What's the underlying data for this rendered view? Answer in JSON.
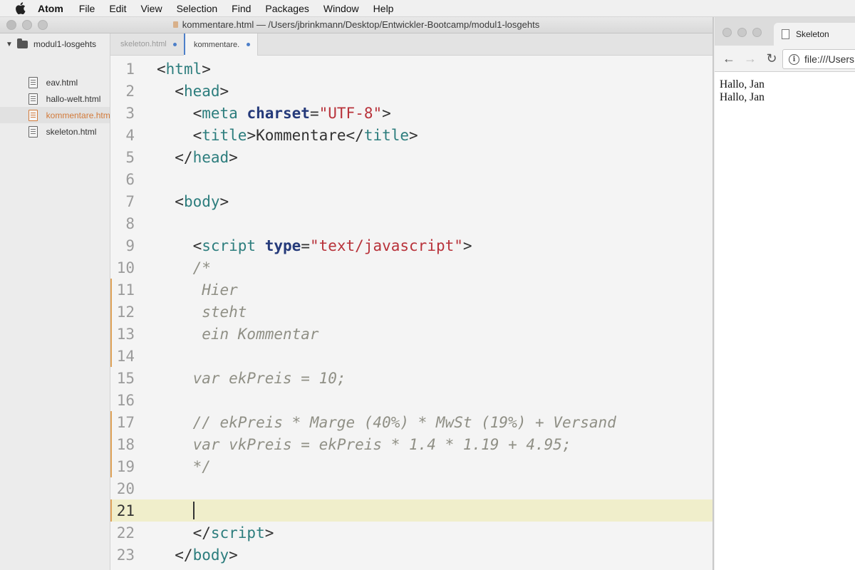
{
  "menubar": {
    "app": "Atom",
    "items": [
      "File",
      "Edit",
      "View",
      "Selection",
      "Find",
      "Packages",
      "Window",
      "Help"
    ]
  },
  "editor_window": {
    "title": "kommentare.html — /Users/jbrinkmann/Desktop/Entwickler-Bootcamp/modul1-losgehts",
    "tree": {
      "root": "modul1-losgehts",
      "files": [
        "eav.html",
        "hallo-welt.html",
        "kommentare.html",
        "skeleton.html"
      ],
      "selected": "kommentare.html"
    },
    "tabs": [
      {
        "label": "skeleton.html",
        "modified": true,
        "active": false
      },
      {
        "label": "kommentare.html",
        "modified": true,
        "active": true
      }
    ],
    "lines": [
      {
        "n": "1",
        "code": [
          {
            "t": "<",
            "c": "pl"
          },
          {
            "t": "html",
            "c": "tg"
          },
          {
            "t": ">",
            "c": "pl"
          }
        ]
      },
      {
        "n": "2",
        "code": [
          {
            "t": "  <",
            "c": "pl"
          },
          {
            "t": "head",
            "c": "tg"
          },
          {
            "t": ">",
            "c": "pl"
          }
        ]
      },
      {
        "n": "3",
        "code": [
          {
            "t": "    <",
            "c": "pl"
          },
          {
            "t": "meta",
            "c": "tg"
          },
          {
            "t": " ",
            "c": "pl"
          },
          {
            "t": "charset",
            "c": "at"
          },
          {
            "t": "=",
            "c": "pl"
          },
          {
            "t": "\"UTF-8\"",
            "c": "st"
          },
          {
            "t": ">",
            "c": "pl"
          }
        ]
      },
      {
        "n": "4",
        "code": [
          {
            "t": "    <",
            "c": "pl"
          },
          {
            "t": "title",
            "c": "tg"
          },
          {
            "t": ">Kommentare</",
            "c": "pl"
          },
          {
            "t": "title",
            "c": "tg"
          },
          {
            "t": ">",
            "c": "pl"
          }
        ]
      },
      {
        "n": "5",
        "code": [
          {
            "t": "  </",
            "c": "pl"
          },
          {
            "t": "head",
            "c": "tg"
          },
          {
            "t": ">",
            "c": "pl"
          }
        ]
      },
      {
        "n": "6",
        "code": []
      },
      {
        "n": "7",
        "code": [
          {
            "t": "  <",
            "c": "pl"
          },
          {
            "t": "body",
            "c": "tg"
          },
          {
            "t": ">",
            "c": "pl"
          }
        ]
      },
      {
        "n": "8",
        "code": []
      },
      {
        "n": "9",
        "code": [
          {
            "t": "    <",
            "c": "pl"
          },
          {
            "t": "script",
            "c": "tg"
          },
          {
            "t": " ",
            "c": "pl"
          },
          {
            "t": "type",
            "c": "at"
          },
          {
            "t": "=",
            "c": "pl"
          },
          {
            "t": "\"text/javascript\"",
            "c": "st"
          },
          {
            "t": ">",
            "c": "pl"
          }
        ]
      },
      {
        "n": "10",
        "code": [
          {
            "t": "    /*",
            "c": "cm"
          }
        ]
      },
      {
        "n": "11",
        "mark": true,
        "code": [
          {
            "t": "     Hier",
            "c": "cm"
          }
        ]
      },
      {
        "n": "12",
        "mark": true,
        "code": [
          {
            "t": "     steht",
            "c": "cm"
          }
        ]
      },
      {
        "n": "13",
        "mark": true,
        "code": [
          {
            "t": "     ein Kommentar",
            "c": "cm"
          }
        ]
      },
      {
        "n": "14",
        "mark": true,
        "code": []
      },
      {
        "n": "15",
        "code": [
          {
            "t": "    var ekPreis = 10;",
            "c": "cm"
          }
        ]
      },
      {
        "n": "16",
        "code": []
      },
      {
        "n": "17",
        "mark": true,
        "code": [
          {
            "t": "    // ekPreis * Marge (40%) * MwSt (19%) + Versand",
            "c": "cm"
          }
        ]
      },
      {
        "n": "18",
        "mark": true,
        "code": [
          {
            "t": "    var vkPreis = ekPreis * 1.4 * 1.19 + 4.95;",
            "c": "cm"
          }
        ]
      },
      {
        "n": "19",
        "mark": true,
        "code": [
          {
            "t": "    */",
            "c": "cm"
          }
        ]
      },
      {
        "n": "20",
        "code": []
      },
      {
        "n": "21",
        "current": true,
        "mark": true,
        "cursor": true,
        "code": [
          {
            "t": "    ",
            "c": "pl"
          }
        ]
      },
      {
        "n": "22",
        "code": [
          {
            "t": "    </",
            "c": "pl"
          },
          {
            "t": "script",
            "c": "tg"
          },
          {
            "t": ">",
            "c": "pl"
          }
        ]
      },
      {
        "n": "23",
        "code": [
          {
            "t": "  </",
            "c": "pl"
          },
          {
            "t": "body",
            "c": "tg"
          },
          {
            "t": ">",
            "c": "pl"
          }
        ]
      }
    ]
  },
  "browser": {
    "tab_title": "Skeleton",
    "url": "file:///Users",
    "content": [
      "Hallo, Jan",
      "Hallo, Jan"
    ]
  },
  "colors": {
    "accent": "#4d7fc9",
    "modified_marker": "#e0a35a",
    "tag": "#2c7d7d",
    "attribute": "#253a7a",
    "string": "#b8323a",
    "comment": "#8f8f85",
    "selected_file": "#d27a3a"
  }
}
